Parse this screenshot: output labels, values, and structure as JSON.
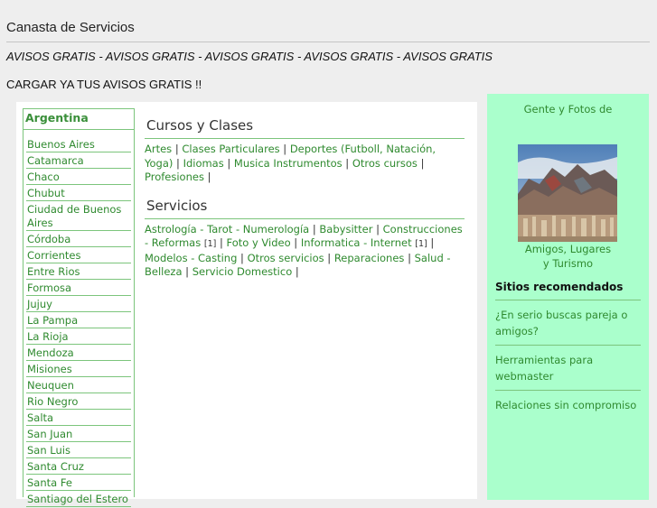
{
  "header": {
    "site_title": "Canasta de Servicios",
    "tagline": "AVISOS GRATIS - AVISOS GRATIS - AVISOS GRATIS - AVISOS GRATIS - AVISOS GRATIS",
    "cta": "CARGAR YA TUS AVISOS GRATIS !!"
  },
  "left_nav": {
    "heading": "Argentina",
    "items": [
      "Buenos Aires",
      "Catamarca",
      "Chaco",
      "Chubut",
      "Ciudad de Buenos Aires",
      "Córdoba",
      "Corrientes",
      "Entre Rios",
      "Formosa",
      "Jujuy",
      "La Pampa",
      "La Rioja",
      "Mendoza",
      "Misiones",
      "Neuquen",
      "Rio Negro",
      "Salta",
      "San Juan",
      "San Luis",
      "Santa Cruz",
      "Santa Fe",
      "Santiago del Estero"
    ]
  },
  "sections": [
    {
      "title": "Cursos y Clases",
      "links": [
        {
          "label": "Artes"
        },
        {
          "label": "Clases Particulares"
        },
        {
          "label": "Deportes (Futboll, Natación, Yoga)"
        },
        {
          "label": "Idiomas"
        },
        {
          "label": "Musica Instrumentos"
        },
        {
          "label": "Otros cursos"
        },
        {
          "label": "Profesiones"
        }
      ]
    },
    {
      "title": "Servicios",
      "links": [
        {
          "label": "Astrología - Tarot - Numerología"
        },
        {
          "label": "Babysitter"
        },
        {
          "label": "Construcciones - Reformas",
          "count": "[1]"
        },
        {
          "label": "Foto y Video"
        },
        {
          "label": "Informatica - Internet",
          "count": "[1]"
        },
        {
          "label": "Modelos - Casting"
        },
        {
          "label": "Otros servicios"
        },
        {
          "label": "Reparaciones"
        },
        {
          "label": "Salud - Belleza"
        },
        {
          "label": "Servicio Domestico"
        }
      ]
    }
  ],
  "sidebar": {
    "gente_text": "Gente y Fotos de",
    "photo_caption_line1": "Amigos, Lugares",
    "photo_caption_line2": "y Turismo",
    "sitios_heading": "Sitios recomendados",
    "recommended": [
      "¿En serio buscas pareja o amigos?",
      "Herramientas para webmaster",
      "Relaciones sin compromiso"
    ]
  },
  "colors": {
    "accent_green": "#2f8a2f",
    "border_green": "#7cc57c",
    "sidebar_bg": "#aaffcc",
    "page_bg": "#eeeeee"
  }
}
